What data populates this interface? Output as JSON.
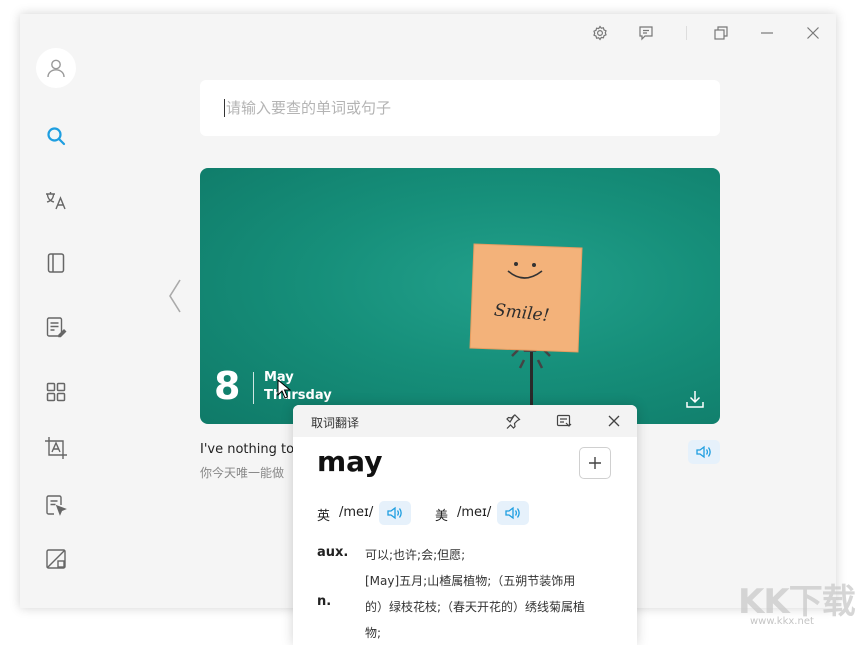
{
  "search": {
    "placeholder": "请输入要查的单词或句子"
  },
  "daily": {
    "day": "8",
    "month": "May",
    "weekday": "Thursday",
    "note_text": "Smile!",
    "quote_en": "I've nothing to",
    "quote_zh": "你今天唯一能做"
  },
  "popup": {
    "title": "取词翻译",
    "word": "may",
    "uk_label": "英",
    "uk_phonetic": "/meɪ/",
    "us_label": "美",
    "us_phonetic": "/meɪ/",
    "definitions": [
      {
        "pos": "aux.",
        "lines": [
          "可以;也许;会;但愿;"
        ]
      },
      {
        "pos": "n.",
        "lines": [
          "[May]五月;山楂属植物;（五朔节装饰用",
          "的）绿枝花枝;（春天开花的）绣线菊属植",
          "物;"
        ]
      }
    ]
  },
  "watermark": {
    "text": "KK下载",
    "url": "www.kkx.net"
  },
  "colors": {
    "accent": "#1e9ee0",
    "banner": "#168f7a",
    "note": "#f3b27a"
  },
  "icons": [
    "user-icon",
    "search-icon",
    "translate-icon",
    "book-icon",
    "notes-icon",
    "apps-grid-icon",
    "screenshot-text-icon",
    "document-select-icon",
    "image-edit-icon",
    "settings-icon",
    "feedback-icon",
    "window-restore-icon",
    "minimize-icon",
    "close-icon",
    "pin-icon",
    "dock-icon",
    "speaker-icon",
    "download-icon",
    "plus-icon",
    "chevron-left-icon"
  ]
}
